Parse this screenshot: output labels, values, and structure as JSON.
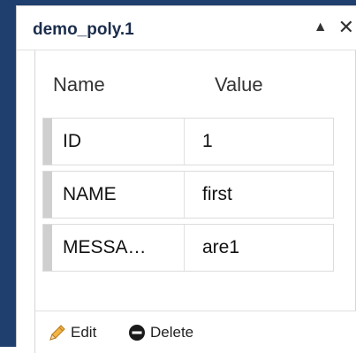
{
  "popup": {
    "title": "demo_poly.1",
    "collapse_icon": "triangle-up",
    "close_icon": "close-x"
  },
  "table": {
    "headers": {
      "name": "Name",
      "value": "Value"
    },
    "rows": [
      {
        "name": "ID",
        "value": "1"
      },
      {
        "name": "NAME",
        "value": "first"
      },
      {
        "name": "MESSA…",
        "value": "are1"
      }
    ]
  },
  "footer": {
    "edit_label": "Edit",
    "edit_icon": "pencil",
    "delete_label": "Delete",
    "delete_icon": "minus-circle"
  },
  "colors": {
    "title_text": "#1c2d4c",
    "map_background": "#1f3f6e",
    "edit_icon": "#e8a23a"
  }
}
